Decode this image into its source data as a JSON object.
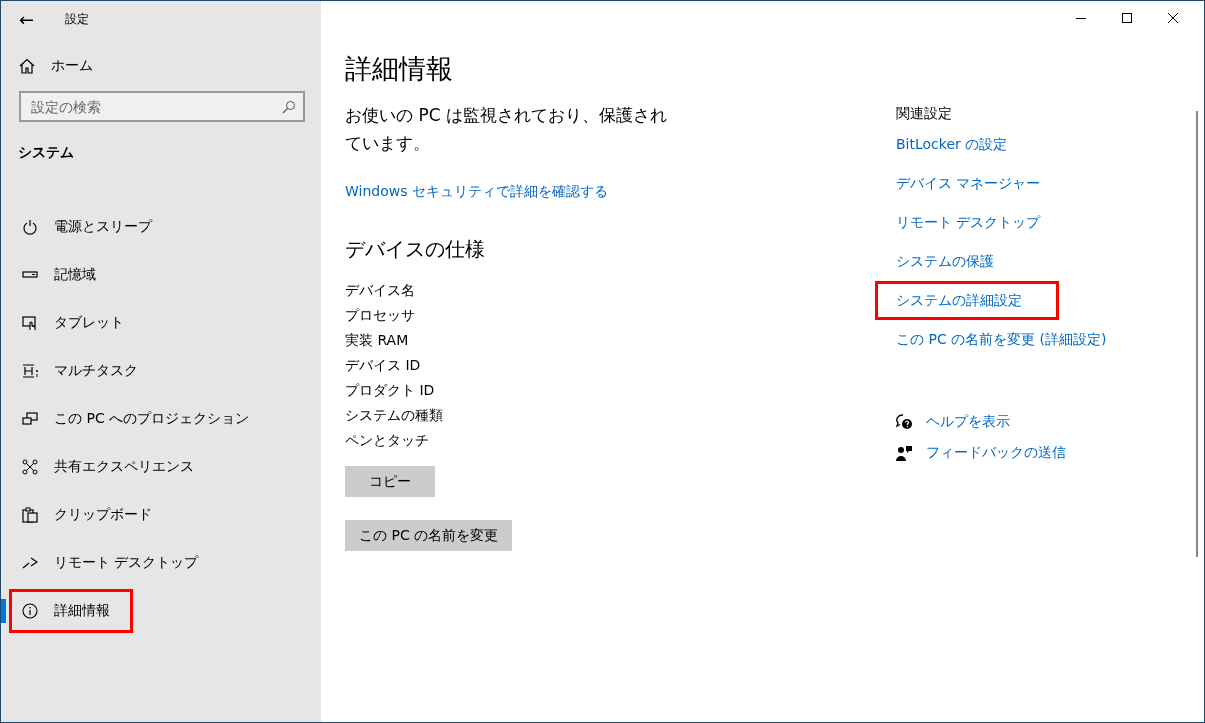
{
  "window": {
    "title": "設定",
    "back": "←"
  },
  "sidebar": {
    "home": "ホーム",
    "search": {
      "placeholder": "設定の検索"
    },
    "section": "システム",
    "items": [
      {
        "label": "電源とスリープ",
        "selected": false,
        "highlighted": false
      },
      {
        "label": "記憶域",
        "selected": false,
        "highlighted": false
      },
      {
        "label": "タブレット",
        "selected": false,
        "highlighted": false
      },
      {
        "label": "マルチタスク",
        "selected": false,
        "highlighted": false
      },
      {
        "label": "この PC へのプロジェクション",
        "selected": false,
        "highlighted": false
      },
      {
        "label": "共有エクスペリエンス",
        "selected": false,
        "highlighted": false
      },
      {
        "label": "クリップボード",
        "selected": false,
        "highlighted": false
      },
      {
        "label": "リモート デスクトップ",
        "selected": false,
        "highlighted": false
      },
      {
        "label": "詳細情報",
        "selected": true,
        "highlighted": true
      }
    ]
  },
  "main": {
    "title": "詳細情報",
    "status": "お使いの PC は監視されており、保護されています。",
    "security_link": "Windows セキュリティで詳細を確認する",
    "specs_title": "デバイスの仕様",
    "specs": [
      "デバイス名",
      "プロセッサ",
      "実装 RAM",
      "デバイス ID",
      "プロダクト ID",
      "システムの種類",
      "ペンとタッチ"
    ],
    "buttons": [
      "コピー",
      "この PC の名前を変更"
    ]
  },
  "related": {
    "title": "関連設定",
    "links": [
      {
        "label": "BitLocker の設定",
        "highlighted": false
      },
      {
        "label": "デバイス マネージャー",
        "highlighted": false
      },
      {
        "label": "リモート デスクトップ",
        "highlighted": false
      },
      {
        "label": "システムの保護",
        "highlighted": false
      },
      {
        "label": "システムの詳細設定",
        "highlighted": true
      },
      {
        "label": "この PC の名前を変更 (詳細設定)",
        "highlighted": false
      }
    ],
    "help": [
      "ヘルプを表示",
      "フィードバックの送信"
    ]
  }
}
